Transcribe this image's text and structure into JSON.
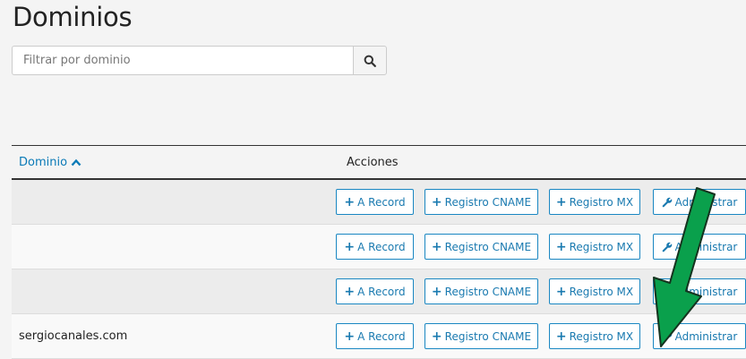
{
  "page": {
    "title": "Dominios"
  },
  "search": {
    "placeholder": "Filtrar por dominio",
    "icon": "search-icon"
  },
  "table": {
    "columns": {
      "domain": "Dominio",
      "actions": "Acciones"
    },
    "sort_icon": "chevron-up-icon",
    "actions": {
      "a_record": "A Record",
      "cname": "Registro CNAME",
      "mx": "Registro MX",
      "admin": "Administrar"
    },
    "rows": [
      {
        "domain": ""
      },
      {
        "domain": ""
      },
      {
        "domain": ""
      },
      {
        "domain": "sergiocanales.com"
      }
    ]
  },
  "annotation": {
    "arrow_color": "#0aa04c",
    "icon": "green-arrow-annotation"
  },
  "colors": {
    "link": "#0a7ab7",
    "button_border": "#1a87c2"
  }
}
